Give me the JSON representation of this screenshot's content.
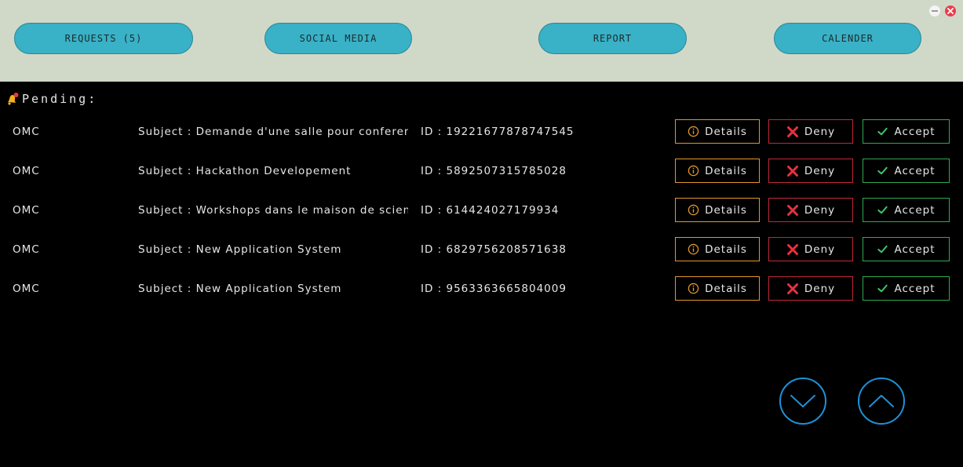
{
  "nav": {
    "items": [
      {
        "label": "REQUESTS (5)"
      },
      {
        "label": "SOCIAL MEDIA"
      },
      {
        "label": "REPORT"
      },
      {
        "label": "CALENDER"
      }
    ]
  },
  "section": {
    "title": "Pending:"
  },
  "requests": [
    {
      "org": "OMC",
      "subject": "Subject : Demande d'une salle pour conferen",
      "id": "ID : 19221677878747545"
    },
    {
      "org": "OMC",
      "subject": "Subject : Hackathon Developement",
      "id": "ID : 5892507315785028"
    },
    {
      "org": "OMC",
      "subject": "Subject : Workshops dans le maison de scien",
      "id": "ID : 614424027179934"
    },
    {
      "org": "OMC",
      "subject": "Subject : New Application System",
      "id": "ID : 6829756208571638"
    },
    {
      "org": "OMC",
      "subject": "Subject : New Application System",
      "id": "ID : 9563363665804009"
    }
  ],
  "actions": {
    "details": "Details",
    "deny": "Deny",
    "accept": "Accept"
  },
  "icons": {
    "minimize": "minimize-icon",
    "close": "close-icon",
    "bell": "bell-icon",
    "details": "info-circle-icon",
    "deny": "x-icon",
    "accept": "check-icon",
    "scroll_down": "chevron-down-icon",
    "scroll_up": "chevron-up-icon"
  },
  "colors": {
    "topbar": "#d0d9c8",
    "nav_button": "#39b1c6",
    "background": "#000000",
    "details": "#e3962a",
    "deny": "#c2283a",
    "accept": "#2eaa4f",
    "scroll": "#1e90d6"
  }
}
